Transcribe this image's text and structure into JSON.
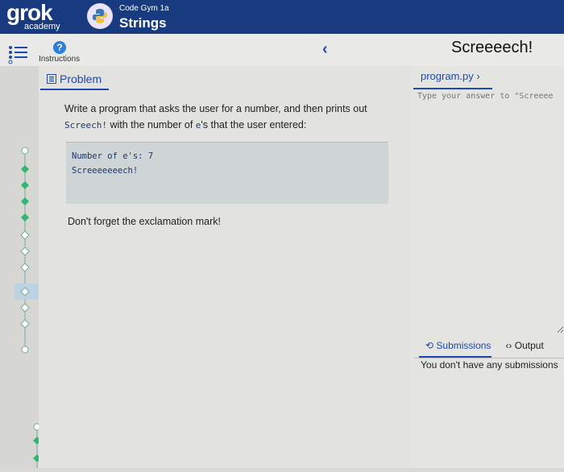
{
  "brand": {
    "logo_text": "grok",
    "logo_sub": "academy"
  },
  "course": {
    "subtitle": "Code Gym 1a",
    "title": "Strings"
  },
  "nav": {
    "instructions_label": "Instructions"
  },
  "exercise": {
    "title": "Screeeech!"
  },
  "problem": {
    "tab_label": "Problem",
    "desc_part1": "Write a program that asks the user for a number, and then prints out ",
    "desc_code1": "Screech!",
    "desc_part2": " with the number of ",
    "desc_code2": "e",
    "desc_part3": "'s that the user entered:",
    "example_line1": "Number of e's: 7",
    "example_line2": "Screeeeeeech!",
    "note": "Don't forget the exclamation mark!"
  },
  "editor": {
    "file_tab": "program.py",
    "placeholder": "Type your answer to \"Screeee"
  },
  "bottom_tabs": {
    "submissions": "Submissions",
    "output": "Output",
    "no_submissions": "You don't have any submissions"
  },
  "colors": {
    "header_bg": "#183b80",
    "accent": "#1f4ab0",
    "progress_done": "#2eb872"
  }
}
